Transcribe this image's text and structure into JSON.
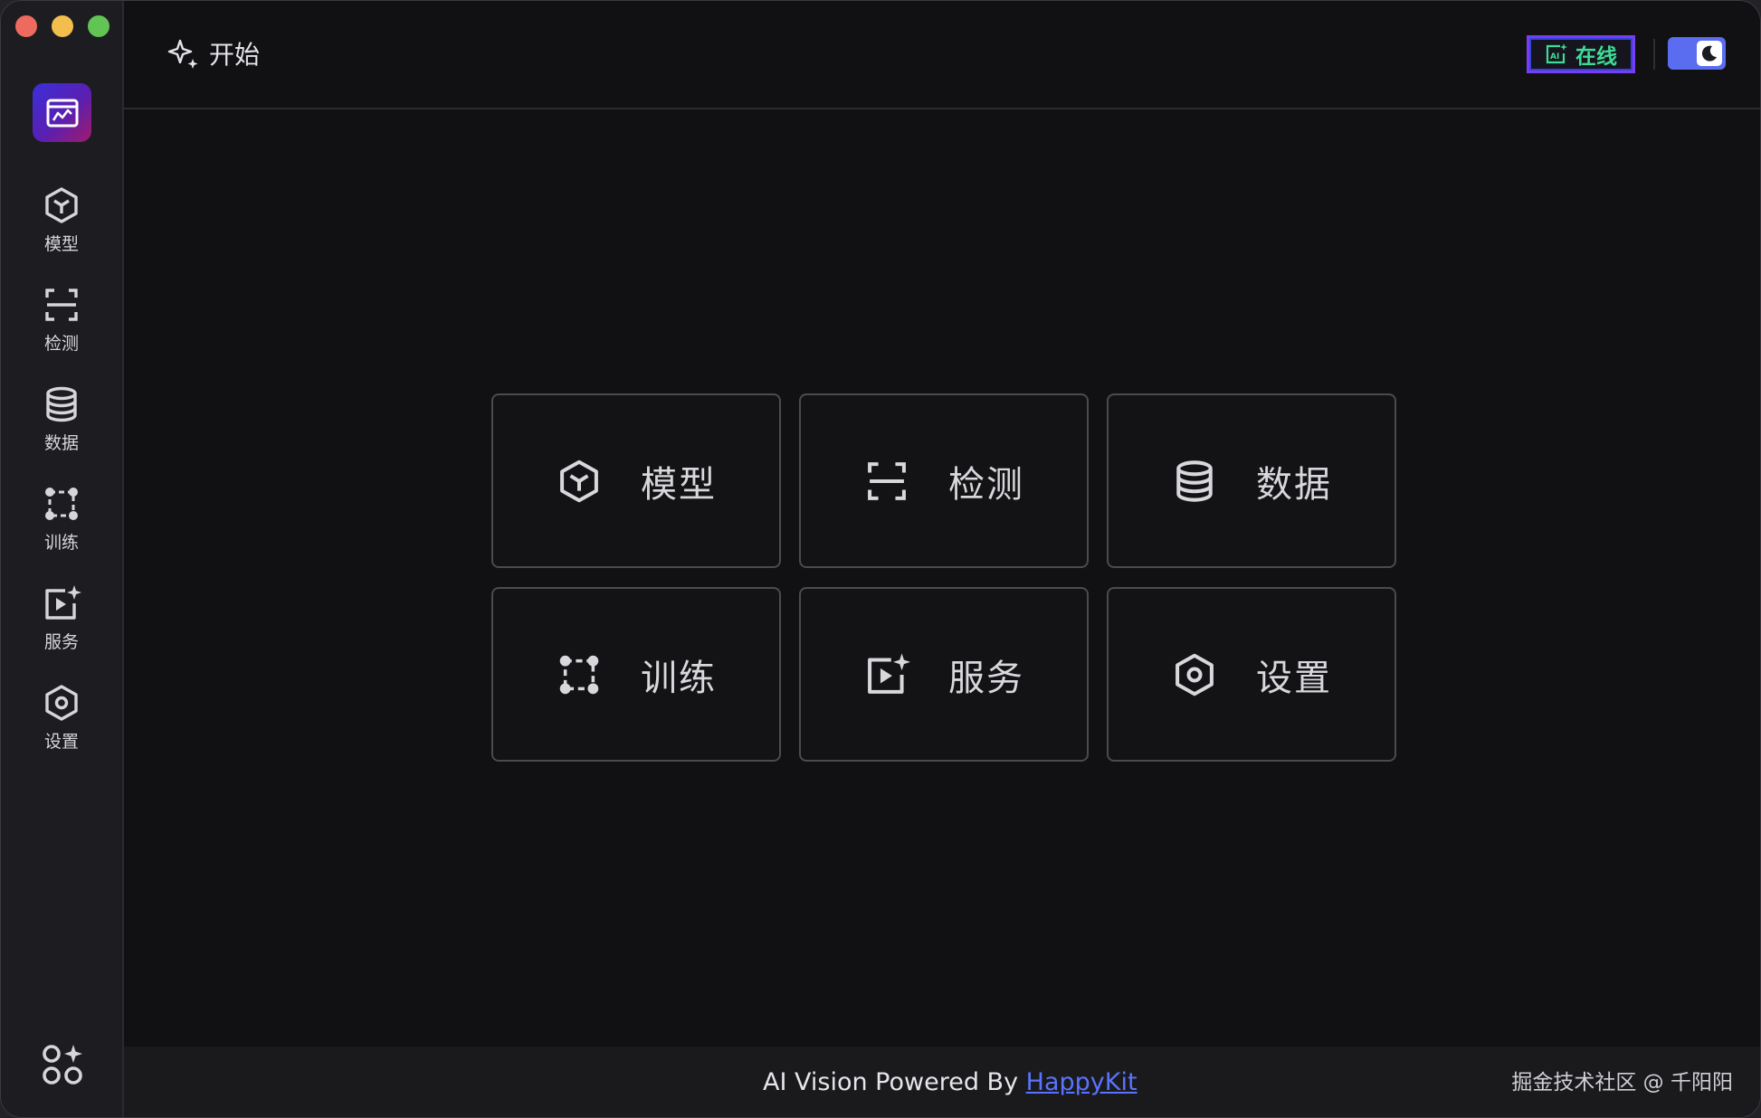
{
  "header": {
    "title": "开始",
    "online_label": "在线"
  },
  "sidebar": {
    "items": [
      {
        "label": "模型"
      },
      {
        "label": "检测"
      },
      {
        "label": "数据"
      },
      {
        "label": "训练"
      },
      {
        "label": "服务"
      },
      {
        "label": "设置"
      }
    ]
  },
  "cards": [
    {
      "label": "模型"
    },
    {
      "label": "检测"
    },
    {
      "label": "数据"
    },
    {
      "label": "训练"
    },
    {
      "label": "服务"
    },
    {
      "label": "设置"
    }
  ],
  "footer": {
    "powered_prefix": "AI Vision Powered By ",
    "powered_link": "HappyKit",
    "credit": "掘金技术社区 @ 千阳阳"
  },
  "colors": {
    "accent": "#5a6cf0",
    "online_text": "#3ddc97",
    "link": "#5a73ff"
  }
}
